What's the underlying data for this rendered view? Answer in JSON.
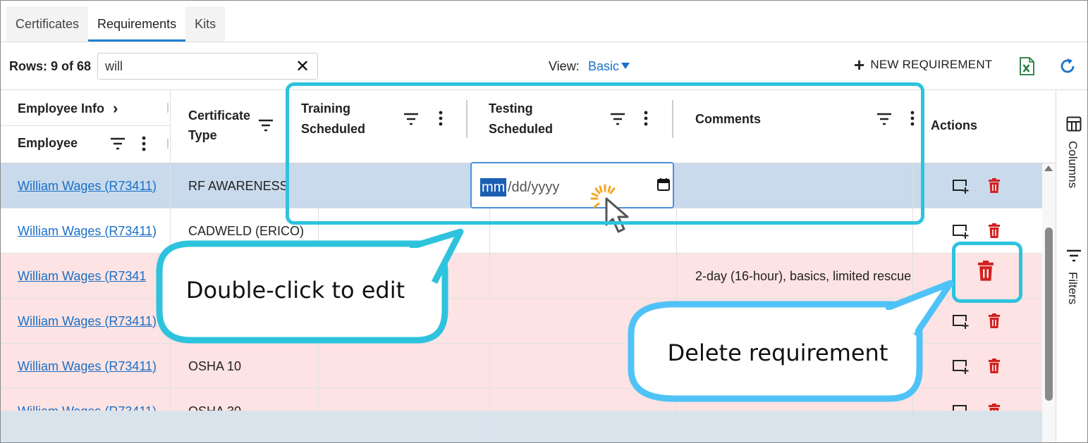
{
  "tabs": [
    {
      "label": "Certificates",
      "active": false
    },
    {
      "label": "Requirements",
      "active": true
    },
    {
      "label": "Kits",
      "active": false
    }
  ],
  "toolbar": {
    "rows_label": "Rows: 9 of 68",
    "search_value": "will",
    "view_label": "View:",
    "view_value": "Basic",
    "new_requirement": "NEW REQUIREMENT"
  },
  "columns": {
    "group_employee_info": "Employee Info",
    "employee": "Employee",
    "certificate_type_line1": "Certificate",
    "certificate_type_line2": "Type",
    "training_line1": "Training",
    "training_line2": "Scheduled",
    "testing_line1": "Testing",
    "testing_line2": "Scheduled",
    "comments": "Comments",
    "actions": "Actions"
  },
  "rows": [
    {
      "employee": "William Wages (R73411)",
      "certificate": "RF AWARENESS (",
      "comments": "",
      "status": "selected"
    },
    {
      "employee": "William Wages (R73411)",
      "certificate": "CADWELD (ERICO)",
      "comments": "",
      "status": "plain"
    },
    {
      "employee": "William Wages (R7341",
      "certificate": "",
      "comments": "2-day (16-hour), basics, limited rescue",
      "status": "error"
    },
    {
      "employee": "William Wages (R73411)",
      "certificate": "",
      "comments": "",
      "status": "error"
    },
    {
      "employee": "William Wages (R73411)",
      "certificate": "OSHA 10",
      "comments": "",
      "status": "error"
    },
    {
      "employee": "William Wages (R73411)",
      "certificate": "OSHA 30",
      "comments": "",
      "status": "error"
    }
  ],
  "date_editor": {
    "mm": "mm",
    "rest": "/dd/yyyy"
  },
  "side_panel": {
    "columns": "Columns",
    "filters": "Filters"
  },
  "callouts": {
    "edit": "Double-click to edit",
    "delete": "Delete requirement"
  },
  "colors": {
    "accent": "#1f7fd1",
    "link": "#1a6fc6",
    "callout": "#2ec3dd",
    "delete": "#d32020",
    "selected_row": "#c8daec",
    "error_row": "#fde3e3"
  }
}
